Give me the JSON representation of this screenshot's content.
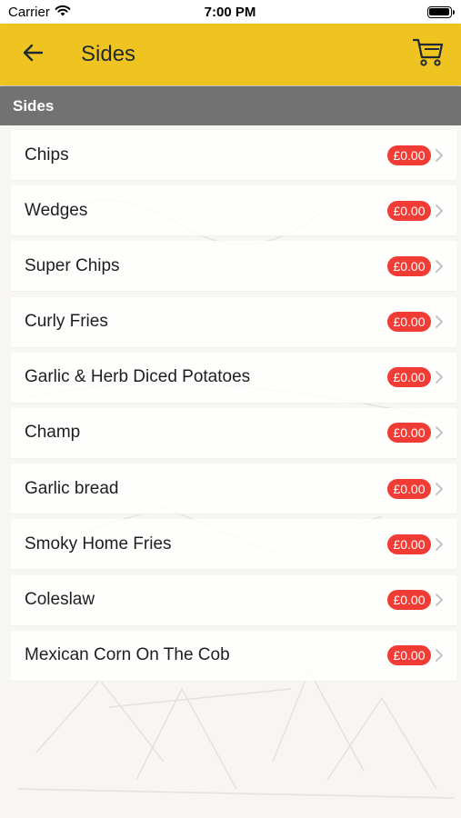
{
  "status_bar": {
    "carrier": "Carrier",
    "time": "7:00 PM"
  },
  "navbar": {
    "title": "Sides",
    "background": "#f0c420",
    "back_icon": "arrow-left-icon",
    "cart_icon": "cart-icon"
  },
  "section": {
    "header": "Sides",
    "background": "#727272"
  },
  "items": [
    {
      "name": "Chips",
      "price": "£0.00"
    },
    {
      "name": "Wedges",
      "price": "£0.00"
    },
    {
      "name": "Super Chips",
      "price": "£0.00"
    },
    {
      "name": "Curly Fries",
      "price": "£0.00"
    },
    {
      "name": "Garlic & Herb Diced Potatoes",
      "price": "£0.00"
    },
    {
      "name": "Champ",
      "price": "£0.00"
    },
    {
      "name": "Garlic bread",
      "price": "£0.00"
    },
    {
      "name": "Smoky Home Fries",
      "price": "£0.00"
    },
    {
      "name": "Coleslaw",
      "price": "£0.00"
    },
    {
      "name": "Mexican Corn On The Cob",
      "price": "£0.00"
    }
  ],
  "colors": {
    "price_badge": "#f13c35",
    "chevron": "#c4c4c4"
  }
}
